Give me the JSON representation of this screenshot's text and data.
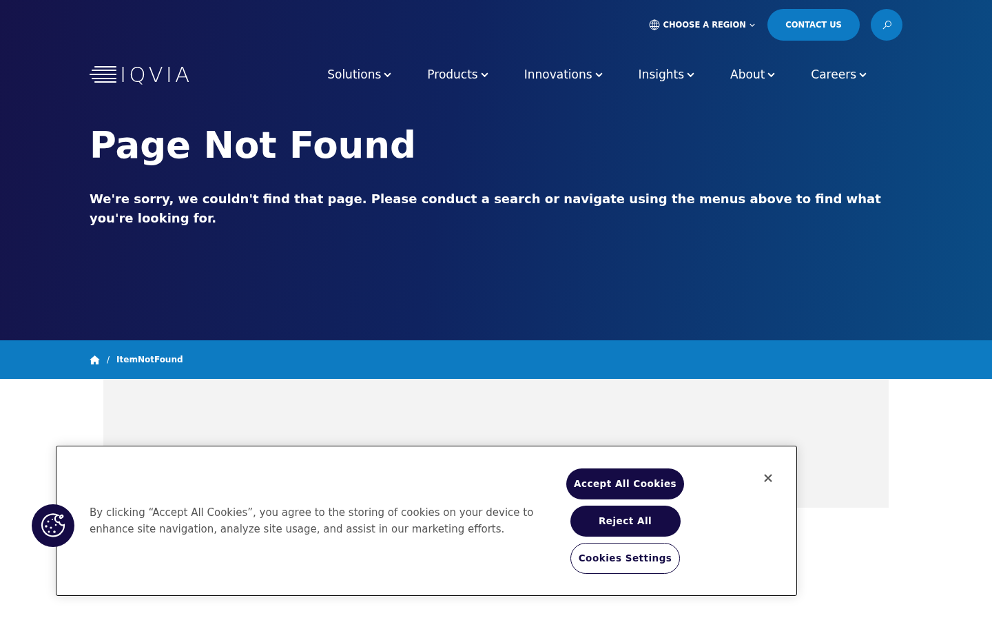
{
  "top_bar": {
    "region_label": "CHOOSE A REGION",
    "contact_button": "CONTACT US"
  },
  "logo": {
    "text": "IQVIA"
  },
  "nav": [
    {
      "label": "Solutions"
    },
    {
      "label": "Products"
    },
    {
      "label": "Innovations"
    },
    {
      "label": "Insights"
    },
    {
      "label": "About"
    },
    {
      "label": "Careers"
    }
  ],
  "hero": {
    "title": "Page Not Found",
    "message": "We're sorry, we couldn't find that page. Please conduct a search or navigate using the menus above to find what you're looking for."
  },
  "breadcrumb": {
    "separator": "/",
    "current": "ItemNotFound"
  },
  "cookie_banner": {
    "text": "By clicking “Accept All Cookies”, you agree to the storing of cookies on your device to enhance site navigation, analyze site usage, and assist in our marketing efforts.",
    "buttons": [
      {
        "label": "Accept All Cookies",
        "kind": "filled"
      },
      {
        "label": "Reject All",
        "kind": "filled"
      },
      {
        "label": "Cookies Settings",
        "kind": "outline"
      }
    ]
  }
}
